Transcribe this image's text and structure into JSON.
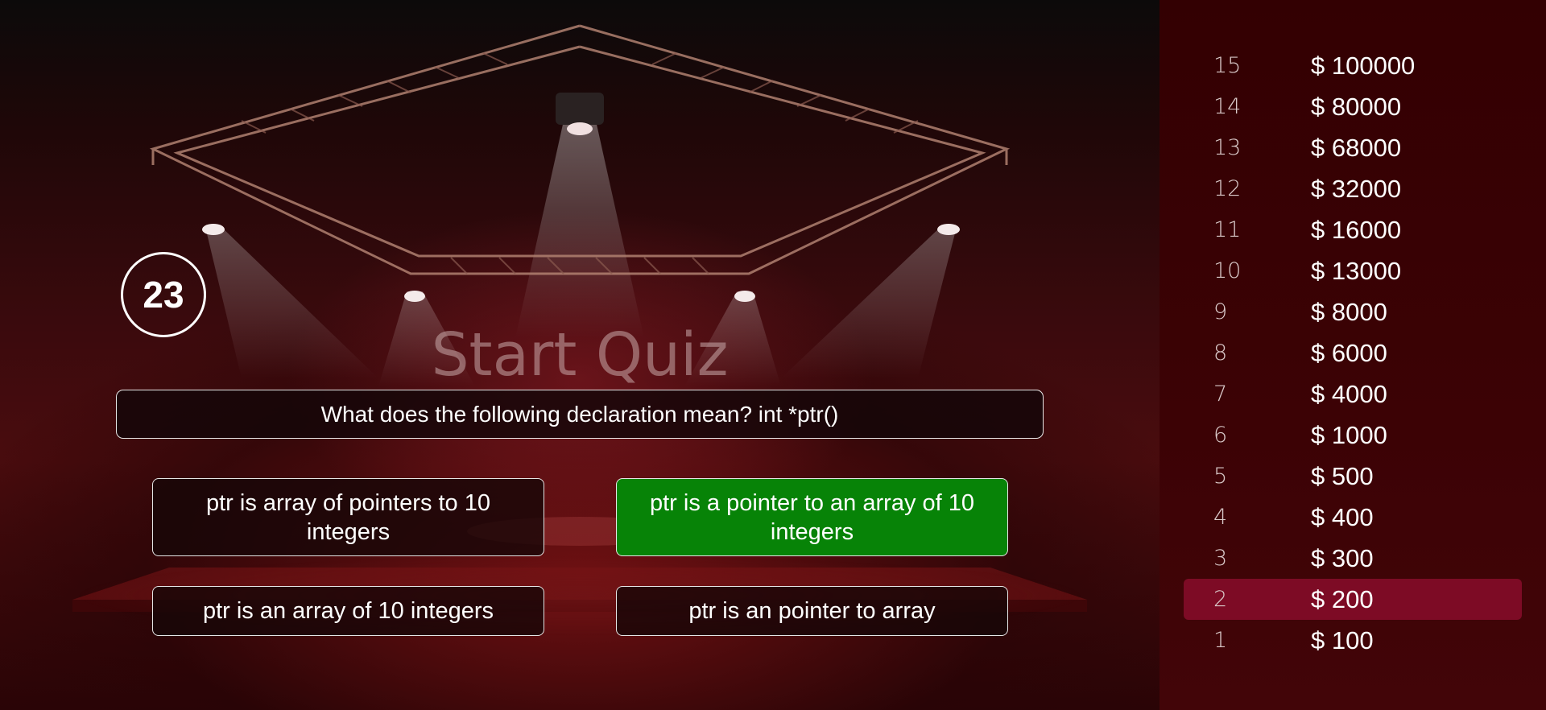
{
  "timer": {
    "value": "23"
  },
  "stage": {
    "watermark": "Start Quiz"
  },
  "question": {
    "text": "What does the following declaration mean? int *ptr()"
  },
  "answers": [
    {
      "text": "ptr is array of pointers to 10 integers",
      "state": "default"
    },
    {
      "text": "ptr is a pointer to an array of 10 integers",
      "state": "correct"
    },
    {
      "text": "ptr is an array of 10 integers",
      "state": "default"
    },
    {
      "text": "ptr is an pointer to array",
      "state": "default"
    }
  ],
  "ladder": {
    "current_level": "2",
    "levels": [
      {
        "num": "15",
        "amount": "$ 100000"
      },
      {
        "num": "14",
        "amount": "$ 80000"
      },
      {
        "num": "13",
        "amount": "$ 68000"
      },
      {
        "num": "12",
        "amount": "$ 32000"
      },
      {
        "num": "11",
        "amount": "$ 16000"
      },
      {
        "num": "10",
        "amount": "$ 13000"
      },
      {
        "num": "9",
        "amount": "$ 8000"
      },
      {
        "num": "8",
        "amount": "$ 6000"
      },
      {
        "num": "7",
        "amount": "$ 4000"
      },
      {
        "num": "6",
        "amount": "$ 1000"
      },
      {
        "num": "5",
        "amount": "$ 500"
      },
      {
        "num": "4",
        "amount": "$ 400"
      },
      {
        "num": "3",
        "amount": "$ 300"
      },
      {
        "num": "2",
        "amount": "$ 200"
      },
      {
        "num": "1",
        "amount": "$ 100"
      }
    ]
  },
  "colors": {
    "correct_answer": "#078307",
    "current_level": "#7d0b25",
    "ladder_bg": "#330002"
  }
}
